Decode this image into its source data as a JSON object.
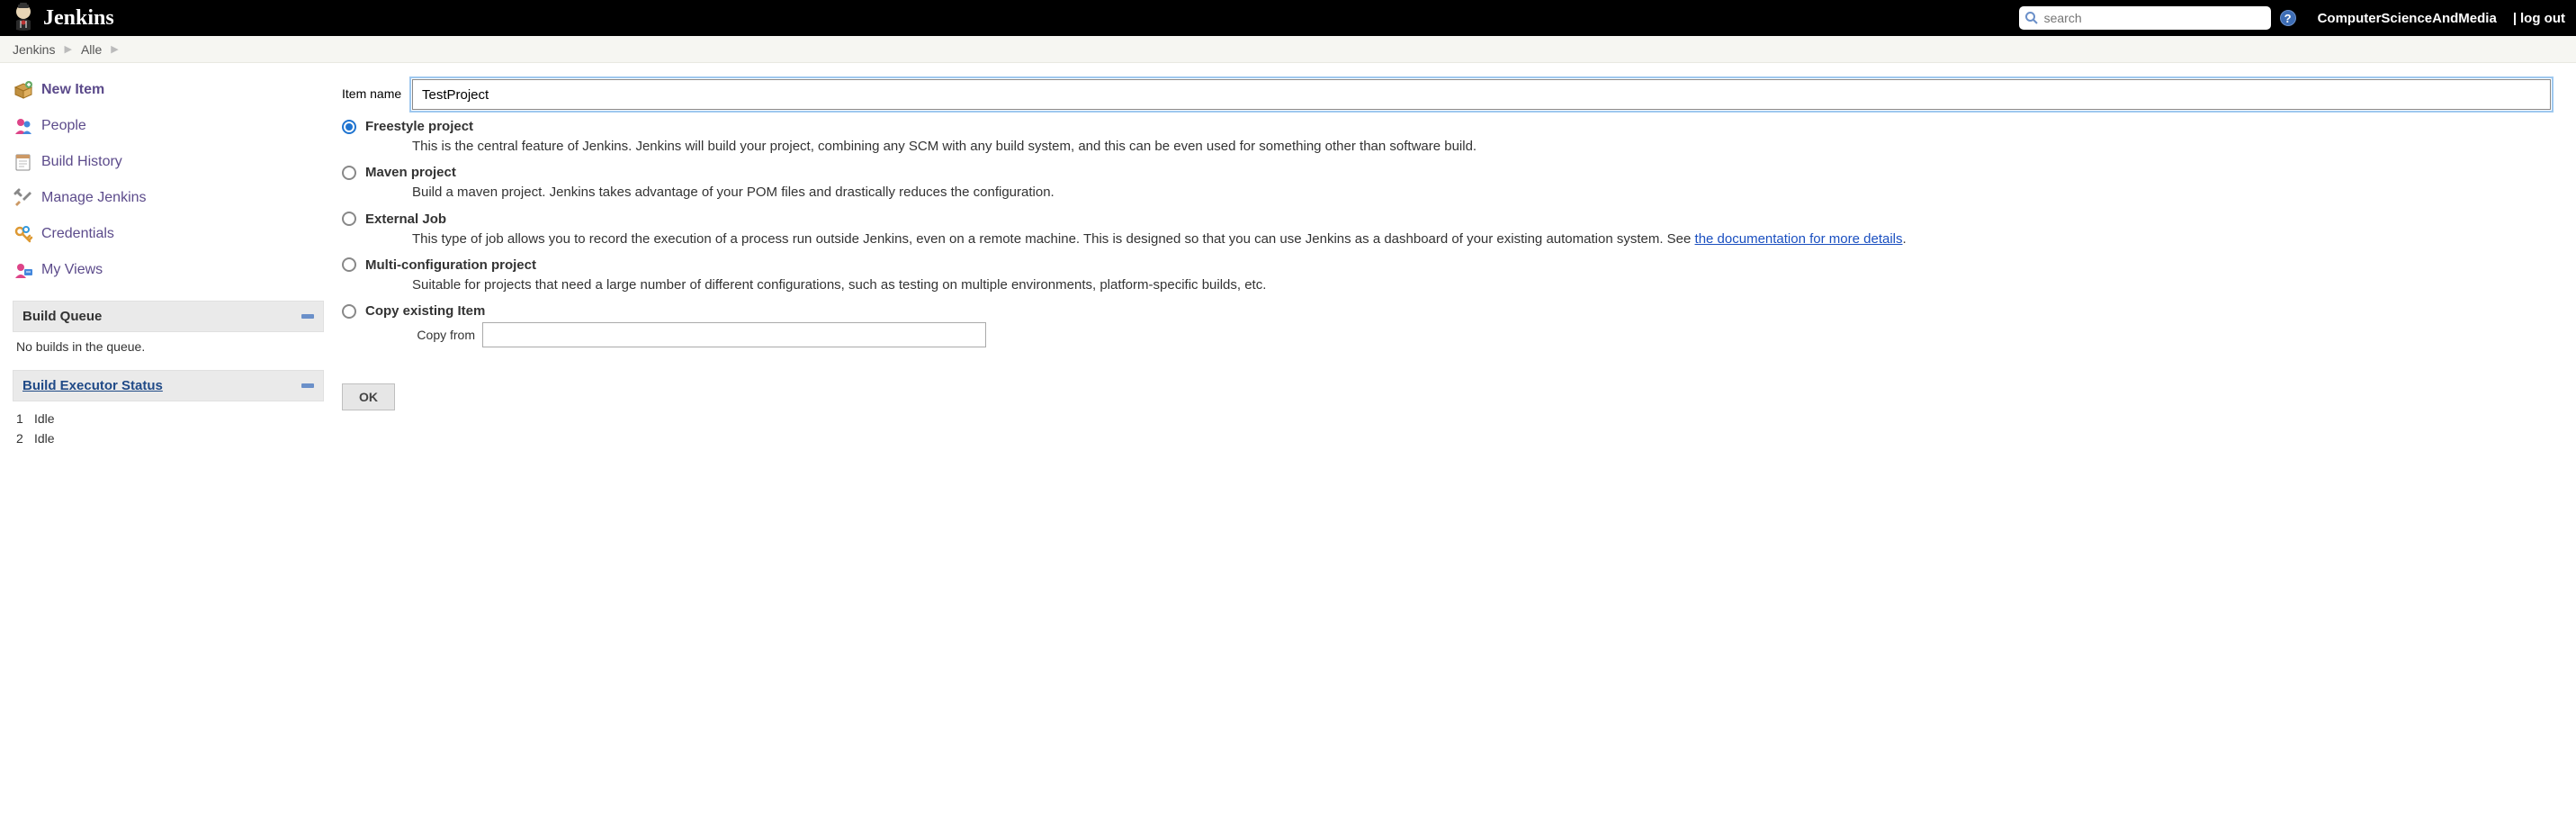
{
  "header": {
    "logo_text": "Jenkins",
    "search_placeholder": "search",
    "help_symbol": "?",
    "username": "ComputerScienceAndMedia",
    "logout_text": "log out"
  },
  "breadcrumbs": [
    "Jenkins",
    "Alle"
  ],
  "sidebar": {
    "tasks": [
      {
        "label": "New Item",
        "active": true,
        "icon": "box-plus"
      },
      {
        "label": "People",
        "active": false,
        "icon": "people"
      },
      {
        "label": "Build History",
        "active": false,
        "icon": "notepad"
      },
      {
        "label": "Manage Jenkins",
        "active": false,
        "icon": "tools"
      },
      {
        "label": "Credentials",
        "active": false,
        "icon": "keys"
      },
      {
        "label": "My Views",
        "active": false,
        "icon": "user-view"
      }
    ],
    "build_queue": {
      "title": "Build Queue",
      "empty_text": "No builds in the queue."
    },
    "build_executor": {
      "title": "Build Executor Status",
      "executors": [
        {
          "index": "1",
          "state": "Idle"
        },
        {
          "index": "2",
          "state": "Idle"
        }
      ]
    }
  },
  "form": {
    "name_label": "Item name",
    "name_value": "TestProject",
    "options": [
      {
        "id": "freestyle",
        "title": "Freestyle project",
        "desc_pre": "This is the central feature of Jenkins. Jenkins will build your project, combining any SCM with any build system, and this can be even used for something other than software build.",
        "link_text": "",
        "desc_post": "",
        "checked": true
      },
      {
        "id": "maven",
        "title": "Maven project",
        "desc_pre": "Build a maven project. Jenkins takes advantage of your POM files and drastically reduces the configuration.",
        "link_text": "",
        "desc_post": "",
        "checked": false
      },
      {
        "id": "external",
        "title": "External Job",
        "desc_pre": "This type of job allows you to record the execution of a process run outside Jenkins, even on a remote machine. This is designed so that you can use Jenkins as a dashboard of your existing automation system. See ",
        "link_text": "the documentation for more details",
        "desc_post": ".",
        "checked": false
      },
      {
        "id": "matrix",
        "title": "Multi-configuration project",
        "desc_pre": "Suitable for projects that need a large number of different configurations, such as testing on multiple environments, platform-specific builds, etc.",
        "link_text": "",
        "desc_post": "",
        "checked": false
      },
      {
        "id": "copy",
        "title": "Copy existing Item",
        "desc_pre": "",
        "link_text": "",
        "desc_post": "",
        "checked": false,
        "copy_from_label": "Copy from",
        "copy_from_value": ""
      }
    ],
    "ok_label": "OK"
  }
}
